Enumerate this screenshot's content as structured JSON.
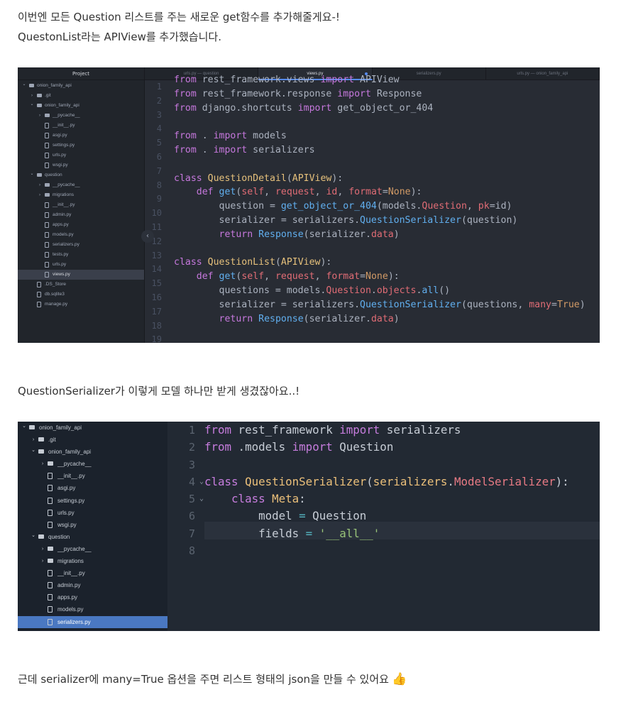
{
  "article": {
    "para1_line1": "이번엔 모든 Question 리스트를 주는 새로운 get함수를 추가해줄게요-!",
    "para1_line2": "QuestonList라는 APIView를 추가했습니다.",
    "para2": "QuestionSerializer가 이렇게 모델 하나만 받게 생겼잖아요..!",
    "para3": "근데 serializer에 many=True 옵션을 주면 리스트 형태의 json을 만들 수 있어요",
    "para3_emoji": "👍"
  },
  "screenshot1": {
    "sidebar_title": "Project",
    "tree": [
      {
        "label": "onion_family_api",
        "type": "folder",
        "depth": 0,
        "expanded": true
      },
      {
        "label": ".git",
        "type": "folder",
        "depth": 1,
        "expanded": false
      },
      {
        "label": "onion_family_api",
        "type": "folder",
        "depth": 1,
        "expanded": true
      },
      {
        "label": "__pycache__",
        "type": "folder",
        "depth": 2,
        "expanded": false
      },
      {
        "label": "__init__.py",
        "type": "file",
        "depth": 2
      },
      {
        "label": "asgi.py",
        "type": "file",
        "depth": 2
      },
      {
        "label": "settings.py",
        "type": "file",
        "depth": 2
      },
      {
        "label": "urls.py",
        "type": "file",
        "depth": 2
      },
      {
        "label": "wsgi.py",
        "type": "file",
        "depth": 2
      },
      {
        "label": "question",
        "type": "folder",
        "depth": 1,
        "expanded": true
      },
      {
        "label": "__pycache__",
        "type": "folder",
        "depth": 2,
        "expanded": false
      },
      {
        "label": "migrations",
        "type": "folder",
        "depth": 2,
        "expanded": false
      },
      {
        "label": "__init__.py",
        "type": "file",
        "depth": 2
      },
      {
        "label": "admin.py",
        "type": "file",
        "depth": 2
      },
      {
        "label": "apps.py",
        "type": "file",
        "depth": 2
      },
      {
        "label": "models.py",
        "type": "file",
        "depth": 2
      },
      {
        "label": "serializers.py",
        "type": "file",
        "depth": 2
      },
      {
        "label": "tests.py",
        "type": "file",
        "depth": 2
      },
      {
        "label": "urls.py",
        "type": "file",
        "depth": 2
      },
      {
        "label": "views.py",
        "type": "file",
        "depth": 2,
        "selected": true
      },
      {
        "label": ".DS_Store",
        "type": "file",
        "depth": 1
      },
      {
        "label": "db.sqlite3",
        "type": "file",
        "depth": 1
      },
      {
        "label": "manage.py",
        "type": "file",
        "depth": 1
      }
    ],
    "collapse_glyph": "‹",
    "tabs": [
      {
        "label": "urls.py — question",
        "active": false
      },
      {
        "label": "views.py",
        "active": true,
        "modified": true
      },
      {
        "label": "serializers.py",
        "active": false
      },
      {
        "label": "urls.py — onion_family_api",
        "active": false
      }
    ],
    "line_numbers": [
      "1",
      "2",
      "3",
      "4",
      "5",
      "6",
      "7",
      "8",
      "9",
      "10",
      "11",
      "12",
      "13",
      "14",
      "15",
      "16",
      "17",
      "18",
      "19"
    ],
    "code_lines": [
      [
        [
          "kw",
          "from"
        ],
        [
          "tx",
          " rest_framework.views "
        ],
        [
          "kw",
          "import"
        ],
        [
          "tx",
          " APIView"
        ]
      ],
      [
        [
          "kw",
          "from"
        ],
        [
          "tx",
          " rest_framework.response "
        ],
        [
          "kw",
          "import"
        ],
        [
          "tx",
          " Response"
        ]
      ],
      [
        [
          "kw",
          "from"
        ],
        [
          "tx",
          " django.shortcuts "
        ],
        [
          "kw",
          "import"
        ],
        [
          "tx",
          " get_object_or_404"
        ]
      ],
      [],
      [
        [
          "kw",
          "from"
        ],
        [
          "tx",
          " . "
        ],
        [
          "kw",
          "import"
        ],
        [
          "tx",
          " models"
        ]
      ],
      [
        [
          "kw",
          "from"
        ],
        [
          "tx",
          " . "
        ],
        [
          "kw",
          "import"
        ],
        [
          "tx",
          " serializers"
        ]
      ],
      [],
      [
        [
          "kw",
          "class"
        ],
        [
          "tx",
          " "
        ],
        [
          "cn",
          "QuestionDetail"
        ],
        [
          "tx",
          "("
        ],
        [
          "cn",
          "APIView"
        ],
        [
          "tx",
          "):"
        ]
      ],
      [
        [
          "tx",
          "    "
        ],
        [
          "kw",
          "def"
        ],
        [
          "tx",
          " "
        ],
        [
          "fn",
          "get"
        ],
        [
          "tx",
          "("
        ],
        [
          "pa",
          "self"
        ],
        [
          "tx",
          ", "
        ],
        [
          "pa",
          "request"
        ],
        [
          "tx",
          ", "
        ],
        [
          "pa",
          "id"
        ],
        [
          "tx",
          ", "
        ],
        [
          "pa",
          "format"
        ],
        [
          "tx",
          "="
        ],
        [
          "nb",
          "None"
        ],
        [
          "tx",
          "):"
        ]
      ],
      [
        [
          "tx",
          "        question = "
        ],
        [
          "fn",
          "get_object_or_404"
        ],
        [
          "tx",
          "(models."
        ],
        [
          "at",
          "Question"
        ],
        [
          "tx",
          ", "
        ],
        [
          "pa",
          "pk"
        ],
        [
          "tx",
          "=id)"
        ]
      ],
      [
        [
          "tx",
          "        serializer = serializers."
        ],
        [
          "fn",
          "QuestionSerializer"
        ],
        [
          "tx",
          "(question)"
        ]
      ],
      [
        [
          "tx",
          "        "
        ],
        [
          "kw",
          "return"
        ],
        [
          "tx",
          " "
        ],
        [
          "fn",
          "Response"
        ],
        [
          "tx",
          "(serializer."
        ],
        [
          "at",
          "data"
        ],
        [
          "tx",
          ")"
        ]
      ],
      [],
      [
        [
          "kw",
          "class"
        ],
        [
          "tx",
          " "
        ],
        [
          "cn",
          "QuestionList"
        ],
        [
          "tx",
          "("
        ],
        [
          "cn",
          "APIView"
        ],
        [
          "tx",
          "):"
        ]
      ],
      [
        [
          "tx",
          "    "
        ],
        [
          "kw",
          "def"
        ],
        [
          "tx",
          " "
        ],
        [
          "fn",
          "get"
        ],
        [
          "tx",
          "("
        ],
        [
          "pa",
          "self"
        ],
        [
          "tx",
          ", "
        ],
        [
          "pa",
          "request"
        ],
        [
          "tx",
          ", "
        ],
        [
          "pa",
          "format"
        ],
        [
          "tx",
          "="
        ],
        [
          "nb",
          "None"
        ],
        [
          "tx",
          "):"
        ]
      ],
      [
        [
          "tx",
          "        questions = models."
        ],
        [
          "at",
          "Question"
        ],
        [
          "tx",
          "."
        ],
        [
          "at",
          "objects"
        ],
        [
          "tx",
          "."
        ],
        [
          "fn",
          "all"
        ],
        [
          "tx",
          "()"
        ]
      ],
      [
        [
          "tx",
          "        serializer = serializers."
        ],
        [
          "fn",
          "QuestionSerializer"
        ],
        [
          "tx",
          "(questions, "
        ],
        [
          "pa",
          "many"
        ],
        [
          "tx",
          "="
        ],
        [
          "nb",
          "True"
        ],
        [
          "tx",
          ")"
        ]
      ],
      [
        [
          "tx",
          "        "
        ],
        [
          "kw",
          "return"
        ],
        [
          "tx",
          " "
        ],
        [
          "fn",
          "Response"
        ],
        [
          "tx",
          "(serializer."
        ],
        [
          "at",
          "data"
        ],
        [
          "tx",
          ")"
        ]
      ],
      []
    ]
  },
  "screenshot2": {
    "tree": [
      {
        "label": "onion_family_api",
        "type": "folder",
        "depth": 0,
        "expanded": true
      },
      {
        "label": ".git",
        "type": "folder",
        "depth": 1,
        "expanded": false
      },
      {
        "label": "onion_family_api",
        "type": "folder",
        "depth": 1,
        "expanded": true
      },
      {
        "label": "__pycache__",
        "type": "folder",
        "depth": 2,
        "expanded": false
      },
      {
        "label": "__init__.py",
        "type": "file",
        "depth": 2
      },
      {
        "label": "asgi.py",
        "type": "file",
        "depth": 2
      },
      {
        "label": "settings.py",
        "type": "file",
        "depth": 2
      },
      {
        "label": "urls.py",
        "type": "file",
        "depth": 2
      },
      {
        "label": "wsgi.py",
        "type": "file",
        "depth": 2
      },
      {
        "label": "question",
        "type": "folder",
        "depth": 1,
        "expanded": true
      },
      {
        "label": "__pycache__",
        "type": "folder",
        "depth": 2,
        "expanded": false
      },
      {
        "label": "migrations",
        "type": "folder",
        "depth": 2,
        "expanded": false
      },
      {
        "label": "__init__.py",
        "type": "file",
        "depth": 2
      },
      {
        "label": "admin.py",
        "type": "file",
        "depth": 2
      },
      {
        "label": "apps.py",
        "type": "file",
        "depth": 2
      },
      {
        "label": "models.py",
        "type": "file",
        "depth": 2
      },
      {
        "label": "serializers.py",
        "type": "file",
        "depth": 2,
        "selected": true
      }
    ],
    "line_numbers": [
      "1",
      "2",
      "3",
      "4",
      "5",
      "6",
      "7",
      "8"
    ],
    "fold_lines": [
      3,
      4
    ],
    "fold_glyph": "⌄",
    "code_lines": [
      [
        [
          "kw",
          "from"
        ],
        [
          "tx",
          " rest_framework "
        ],
        [
          "kw",
          "import"
        ],
        [
          "tx",
          " serializers"
        ]
      ],
      [
        [
          "kw",
          "from"
        ],
        [
          "tx",
          " .models "
        ],
        [
          "kw",
          "import"
        ],
        [
          "tx",
          " Question"
        ]
      ],
      [],
      [
        [
          "kw",
          "class"
        ],
        [
          "tx",
          " "
        ],
        [
          "cn",
          "QuestionSerializer"
        ],
        [
          "tx",
          "("
        ],
        [
          "cn",
          "serializers"
        ],
        [
          "tx",
          "."
        ],
        [
          "at",
          "ModelSerializer"
        ],
        [
          "tx",
          "):"
        ]
      ],
      [
        [
          "tx",
          "    "
        ],
        [
          "kw",
          "class"
        ],
        [
          "tx",
          " "
        ],
        [
          "cn",
          "Meta"
        ],
        [
          "tx",
          ":"
        ]
      ],
      [
        [
          "tx",
          "        model "
        ],
        [
          "op",
          "="
        ],
        [
          "tx",
          " Question"
        ]
      ],
      [
        [
          "tx",
          "        fields "
        ],
        [
          "op",
          "="
        ],
        [
          "tx",
          " "
        ],
        [
          "st",
          "'__all__'"
        ]
      ],
      []
    ]
  },
  "syntax_colors": {
    "shot1": {
      "kw": "#c678dd",
      "tx": "#abb2bf",
      "cn": "#e5c07b",
      "fn": "#61afef",
      "pa": "#e06c75",
      "nb": "#d19a66",
      "at": "#e06c75",
      "op": "#56b6c2",
      "st": "#98c379"
    },
    "shot2": {
      "kw": "#c77dde",
      "tx": "#c7cdd6",
      "cn": "#ecc07a",
      "fn": "#61afef",
      "pa": "#e06c75",
      "nb": "#d19a66",
      "at": "#e87a84",
      "op": "#56b6c2",
      "st": "#98c379"
    }
  }
}
